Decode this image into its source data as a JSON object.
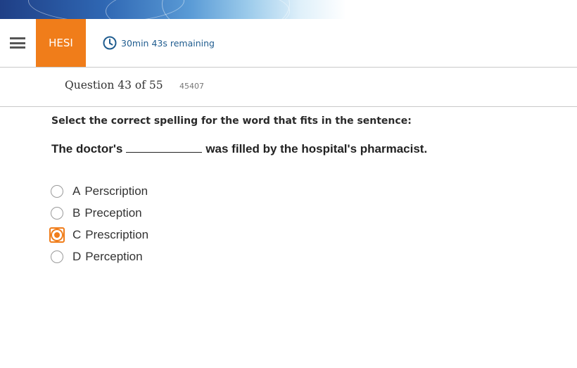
{
  "header": {
    "brand": "HESI",
    "timer_text": "30min 43s remaining",
    "accent_color": "#f07d1a",
    "timer_color": "#1f5c8f"
  },
  "question": {
    "label": "Question 43 of 55",
    "id": "45407",
    "prompt": "Select the correct spelling for the word that fits in the sentence:",
    "sentence_before": "The doctor's",
    "sentence_after": "was filled by the hospital's pharmacist."
  },
  "options": [
    {
      "letter": "A",
      "text": "Perscription",
      "selected": false
    },
    {
      "letter": "B",
      "text": "Preception",
      "selected": false
    },
    {
      "letter": "C",
      "text": "Prescription",
      "selected": true
    },
    {
      "letter": "D",
      "text": "Perception",
      "selected": false
    }
  ],
  "icons": {
    "menu": "hamburger-menu-icon",
    "timer": "clock-icon",
    "radio": "radio-button-icon"
  }
}
